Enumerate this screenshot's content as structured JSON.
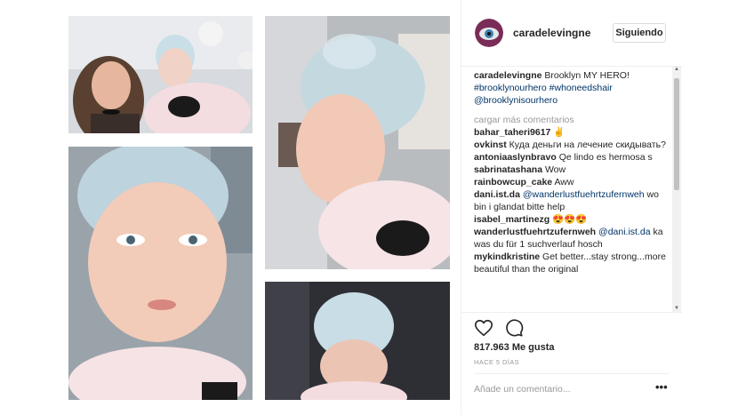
{
  "post": {
    "username": "caradelevingne",
    "follow_label": "Siguiendo",
    "caption": {
      "user": "caradelevingne",
      "text": " Brooklyn MY HERO! ",
      "tags": [
        "#brooklynourhero",
        "#whoneedshair"
      ],
      "mention": "@brooklynisourhero"
    },
    "load_more": "cargar más comentarios",
    "comments": [
      {
        "user": "bahar_taheri9617",
        "mention": "",
        "text": " ✌"
      },
      {
        "user": "ovkinst",
        "mention": "",
        "text": " Куда деньги на лечение скидывать?"
      },
      {
        "user": "antoniaaslynbravo",
        "mention": "",
        "text": " Qe lindo es hermosa s"
      },
      {
        "user": "sabrinatashana",
        "mention": "",
        "text": " Wow"
      },
      {
        "user": "rainbowcup_cake",
        "mention": "",
        "text": " Aww"
      },
      {
        "user": "dani.ist.da",
        "mention": "@wanderlustfuehrtzufernweh",
        "text": " wo bin i glandat bitte help"
      },
      {
        "user": "isabel_martinezg",
        "mention": "",
        "text": " 😍😍😍"
      },
      {
        "user": "wanderlustfuehrtzufernweh",
        "mention": "@dani.ist.da",
        "text": " ka was du für 1 suchverlauf hosch"
      },
      {
        "user": "mykindkristine",
        "mention": "",
        "text": " Get better...stay strong...more beautiful than the original"
      }
    ],
    "likes": "817.963 Me gusta",
    "timestamp": "HACE 5 DÍAS",
    "add_comment_placeholder": "Añade un comentario...",
    "options_label": "•••"
  },
  "icons": {
    "like": "heart-icon",
    "comment": "comment-icon"
  },
  "colors": {
    "link": "#003569",
    "muted": "#999999",
    "border": "#efefef"
  }
}
